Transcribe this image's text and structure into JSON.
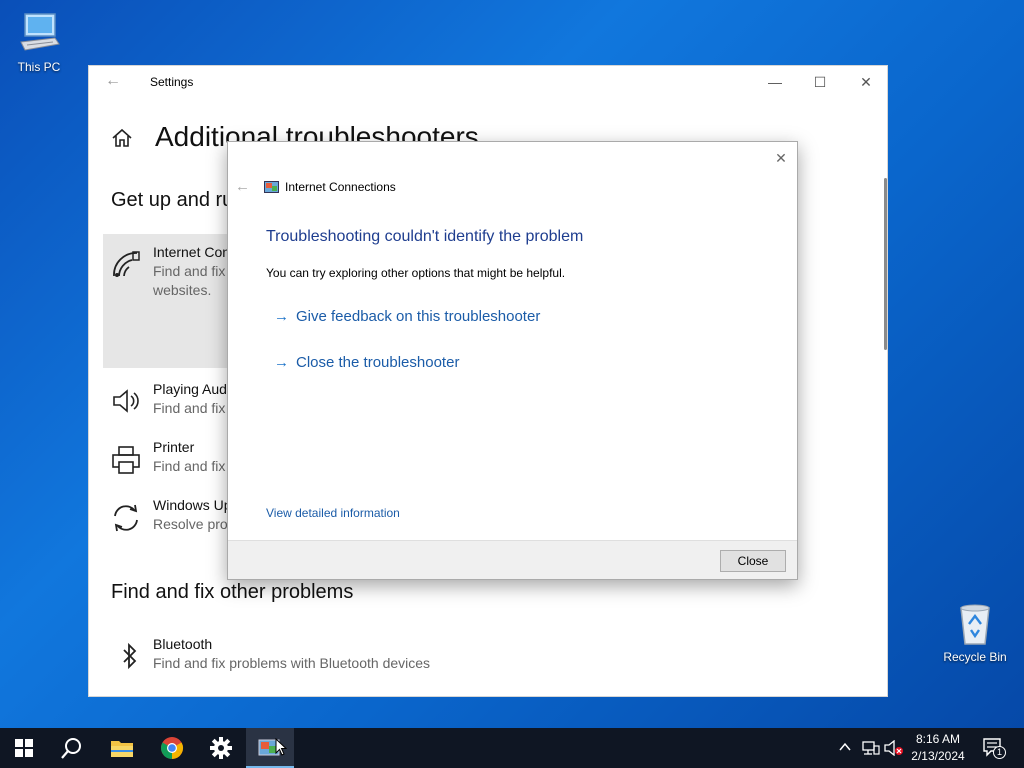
{
  "desktop": {
    "icons": [
      {
        "label": "This PC",
        "icon": "computer-icon"
      },
      {
        "label": "Recycle Bin",
        "icon": "recycle-bin-icon"
      }
    ]
  },
  "settings": {
    "window_title": "Settings",
    "page_title": "Additional troubleshooters",
    "section1_title": "Get up and ru",
    "items": [
      {
        "name": "Internet Con",
        "desc": "Find and fix",
        "desc2": "websites.",
        "icon": "wifi-icon"
      },
      {
        "name": "Playing Audi",
        "desc": "Find and fix",
        "icon": "speaker-icon"
      },
      {
        "name": "Printer",
        "desc": "Find and fix",
        "icon": "printer-icon"
      },
      {
        "name": "Windows Up",
        "desc": "Resolve prob",
        "icon": "sync-icon"
      }
    ],
    "section2_title": "Find and fix other problems",
    "other_items": [
      {
        "name": "Bluetooth",
        "desc": "Find and fix problems with Bluetooth devices",
        "icon": "bluetooth-icon"
      }
    ]
  },
  "dialog": {
    "title": "Internet Connections",
    "heading": "Troubleshooting couldn't identify the problem",
    "subtext": "You can try exploring other options that might be helpful.",
    "options": [
      {
        "label": "Give feedback on this troubleshooter"
      },
      {
        "label": "Close the troubleshooter"
      }
    ],
    "details_link": "View detailed information",
    "close_button": "Close"
  },
  "taskbar": {
    "time": "8:16 AM",
    "date": "2/13/2024",
    "notification_count": "1",
    "accent": "#76b9ed"
  }
}
